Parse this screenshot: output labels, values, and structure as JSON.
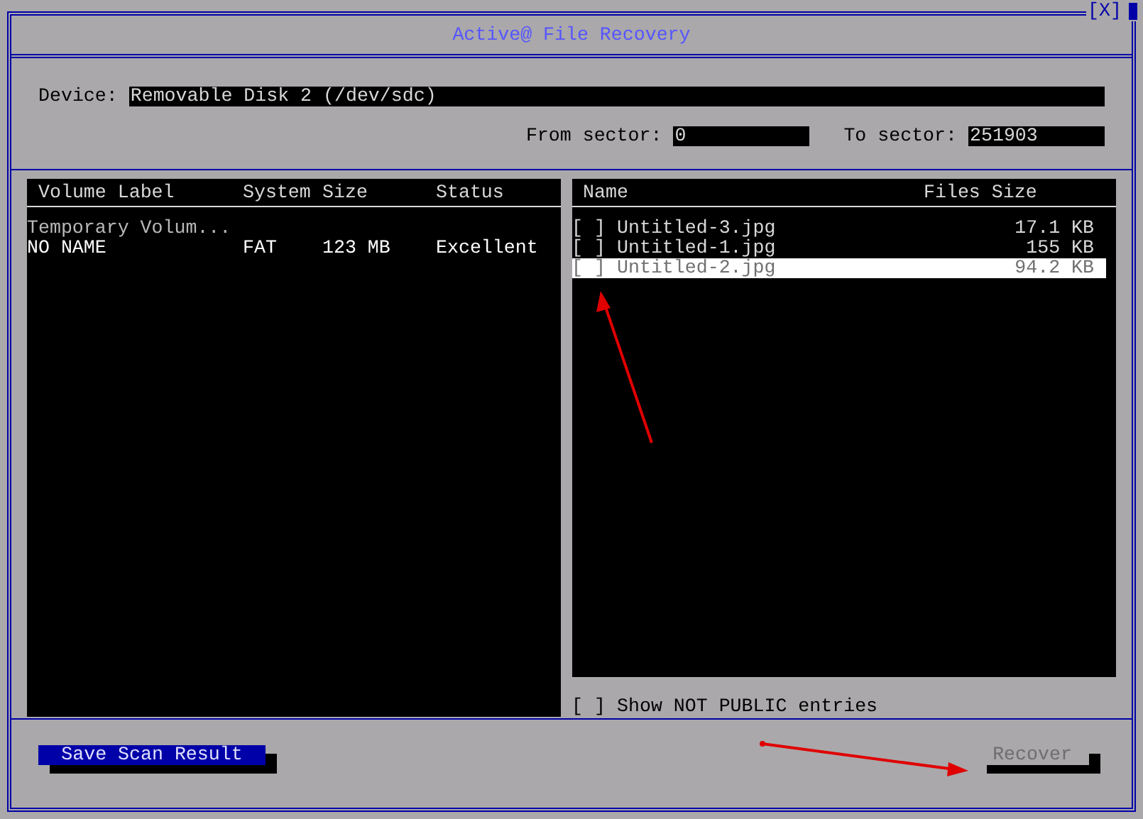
{
  "window": {
    "title": "Active@ File Recovery",
    "close": "[X]"
  },
  "device": {
    "label": "Device:",
    "value": "Removable Disk 2 (/dev/sdc)"
  },
  "from_sector": {
    "label": "From sector:",
    "value": "0"
  },
  "to_sector": {
    "label": "To sector:",
    "value": "251903"
  },
  "volumes": {
    "columns": [
      "Volume Label",
      "System",
      "Size",
      "Status"
    ],
    "rows": [
      {
        "kind": "group",
        "label": "Temporary Volum..."
      },
      {
        "kind": "volume",
        "label": "NO NAME",
        "system": "FAT",
        "size": "123 MB",
        "status": "Excellent"
      }
    ]
  },
  "files": {
    "columns": [
      "Name",
      "Files Size"
    ],
    "rows": [
      {
        "box": "[ ]",
        "checked": false,
        "name": "Untitled-3.jpg",
        "size": "17.1 KB",
        "selected": false
      },
      {
        "box": "[ ]",
        "checked": false,
        "name": "Untitled-1.jpg",
        "size": "155 KB",
        "selected": false
      },
      {
        "box": "[ ]",
        "checked": false,
        "name": "Untitled-2.jpg",
        "size": "94.2 KB",
        "selected": true
      }
    ]
  },
  "show_not_public": {
    "box": "[ ]",
    "checked": false,
    "label": "Show NOT PUBLIC entries"
  },
  "buttons": [
    {
      "label": "Save Scan Result",
      "focused": true,
      "disabled": false
    },
    {
      "label": "Recover",
      "focused": false,
      "disabled": true
    }
  ]
}
